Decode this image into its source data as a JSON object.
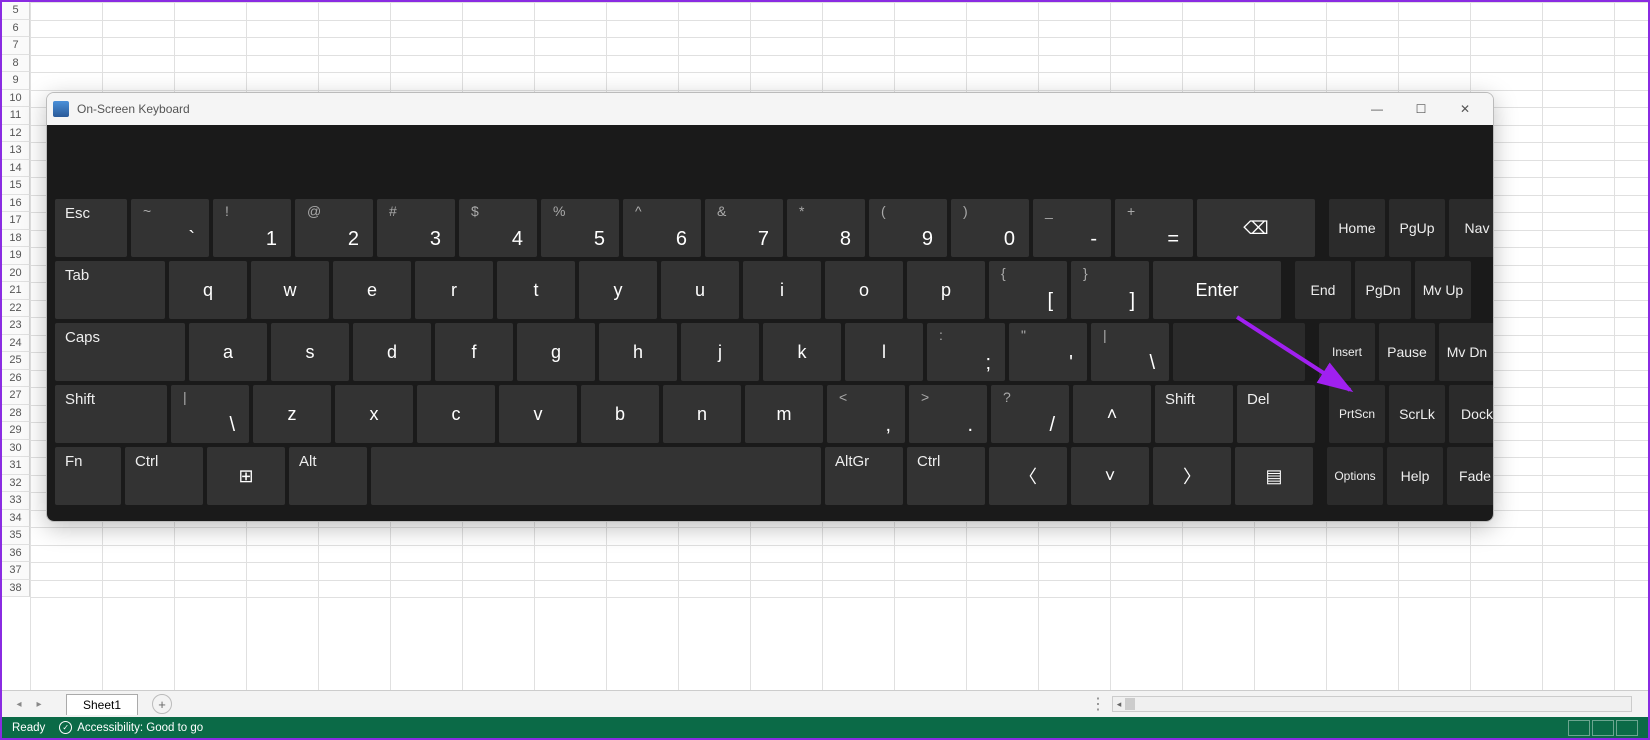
{
  "excel": {
    "first_visible_row": 5,
    "last_visible_row": 38,
    "sheet_tab": "Sheet1",
    "status_ready": "Ready",
    "accessibility": "Accessibility: Good to go"
  },
  "osk": {
    "title": "On-Screen Keyboard",
    "rows": {
      "r1": {
        "esc": "Esc",
        "keys": [
          {
            "sec": "~",
            "pri": "`"
          },
          {
            "sec": "!",
            "pri": "1"
          },
          {
            "sec": "@",
            "pri": "2"
          },
          {
            "sec": "#",
            "pri": "3"
          },
          {
            "sec": "$",
            "pri": "4"
          },
          {
            "sec": "%",
            "pri": "5"
          },
          {
            "sec": "^",
            "pri": "6"
          },
          {
            "sec": "&",
            "pri": "7"
          },
          {
            "sec": "*",
            "pri": "8"
          },
          {
            "sec": "(",
            "pri": "9"
          },
          {
            "sec": ")",
            "pri": "0"
          },
          {
            "sec": "_",
            "pri": "-"
          },
          {
            "sec": "+",
            "pri": "="
          }
        ],
        "bksp": "⌫",
        "fn": [
          "Home",
          "PgUp",
          "Nav"
        ]
      },
      "r2": {
        "tab": "Tab",
        "keys": [
          "q",
          "w",
          "e",
          "r",
          "t",
          "y",
          "u",
          "i",
          "o",
          "p"
        ],
        "brackets": [
          {
            "sec": "{",
            "pri": "["
          },
          {
            "sec": "}",
            "pri": "]"
          }
        ],
        "enter": "Enter",
        "fn": [
          "End",
          "PgDn",
          "Mv Up"
        ]
      },
      "r3": {
        "caps": "Caps",
        "keys": [
          "a",
          "s",
          "d",
          "f",
          "g",
          "h",
          "j",
          "k",
          "l"
        ],
        "punct": [
          {
            "sec": ":",
            "pri": ";"
          },
          {
            "sec": "\"",
            "pri": "'"
          },
          {
            "sec": "|",
            "pri": "\\"
          }
        ],
        "fn": [
          "Insert",
          "Pause",
          "Mv Dn"
        ]
      },
      "r4": {
        "shift_l": "Shift",
        "backslash": {
          "sec": "|",
          "pri": "\\"
        },
        "keys": [
          "z",
          "x",
          "c",
          "v",
          "b",
          "n",
          "m"
        ],
        "punct": [
          {
            "sec": "<",
            "pri": ","
          },
          {
            "sec": ">",
            "pri": "."
          },
          {
            "sec": "?",
            "pri": "/"
          }
        ],
        "up": "˄",
        "shift_r": "Shift",
        "del": "Del",
        "fn": [
          "PrtScn",
          "ScrLk",
          "Dock"
        ]
      },
      "r5": {
        "fn": "Fn",
        "ctrl_l": "Ctrl",
        "win": "⊞",
        "alt": "Alt",
        "altgr": "AltGr",
        "ctrl_r": "Ctrl",
        "left": "〈",
        "down": "˅",
        "right": "〉",
        "menu": "▤",
        "fnkeys": [
          "Options",
          "Help",
          "Fade"
        ]
      }
    }
  }
}
